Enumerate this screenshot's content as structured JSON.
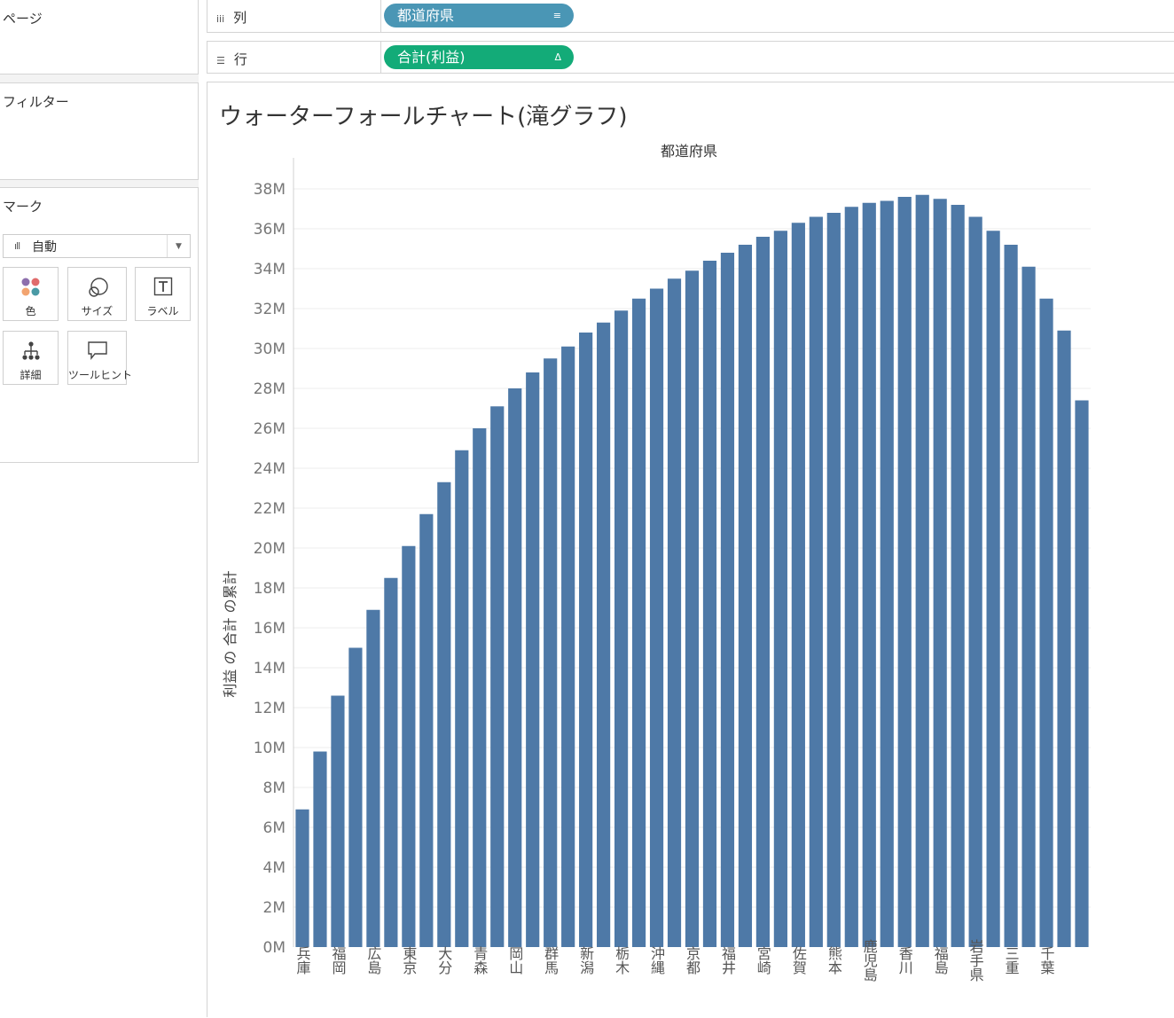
{
  "pages": {
    "title": "ページ"
  },
  "filters": {
    "title": "フィルター"
  },
  "marks": {
    "title": "マーク",
    "mark_type": "自動",
    "buttons": [
      {
        "label": "色",
        "icon": "color-icon"
      },
      {
        "label": "サイズ",
        "icon": "size-icon"
      },
      {
        "label": "ラベル",
        "icon": "label-icon"
      },
      {
        "label": "詳細",
        "icon": "detail-icon"
      },
      {
        "label": "ツールヒント",
        "icon": "tooltip-icon"
      }
    ]
  },
  "shelves": {
    "columns": {
      "label": "列",
      "pill": "都道府県"
    },
    "rows": {
      "label": "行",
      "pill": "合計(利益)"
    }
  },
  "sheet": {
    "title": "ウォーターフォールチャート(滝グラフ)"
  },
  "colors": {
    "bar": "#4e79a7",
    "columns_pill": "#4a96b5",
    "rows_pill": "#13ab78"
  },
  "chart_data": {
    "type": "bar",
    "title": "",
    "x_header": "都道府県",
    "ylabel": "利益 の 合計 の累計",
    "ylim": [
      0,
      38000000
    ],
    "y_ticks": [
      "0M",
      "2M",
      "4M",
      "6M",
      "8M",
      "10M",
      "12M",
      "14M",
      "16M",
      "18M",
      "20M",
      "22M",
      "24M",
      "26M",
      "28M",
      "30M",
      "32M",
      "34M",
      "36M",
      "38M"
    ],
    "categories": [
      "兵庫",
      "",
      "福岡",
      "",
      "広島",
      "",
      "東京",
      "",
      "大分",
      "",
      "青森",
      "",
      "岡山",
      "",
      "群馬",
      "",
      "新潟",
      "",
      "栃木",
      "",
      "沖縄",
      "",
      "京都",
      "",
      "福井",
      "",
      "宮崎",
      "",
      "佐賀",
      "",
      "熊本",
      "",
      "鹿児島",
      "",
      "香川",
      "",
      "福島",
      "",
      "岩手県",
      "",
      "三重",
      "",
      "千葉",
      ""
    ],
    "values": [
      6.9,
      9.8,
      12.6,
      15.0,
      16.9,
      18.5,
      20.1,
      21.7,
      23.3,
      24.9,
      26.0,
      27.1,
      28.0,
      28.8,
      29.5,
      30.1,
      30.8,
      31.3,
      31.9,
      32.5,
      33.0,
      33.5,
      33.9,
      34.4,
      34.8,
      35.2,
      35.6,
      35.9,
      36.3,
      36.6,
      36.8,
      37.1,
      37.3,
      37.4,
      37.6,
      37.7,
      37.5,
      37.2,
      36.6,
      35.9,
      35.2,
      34.1,
      32.5,
      30.9,
      27.4
    ],
    "value_unit": "M"
  }
}
